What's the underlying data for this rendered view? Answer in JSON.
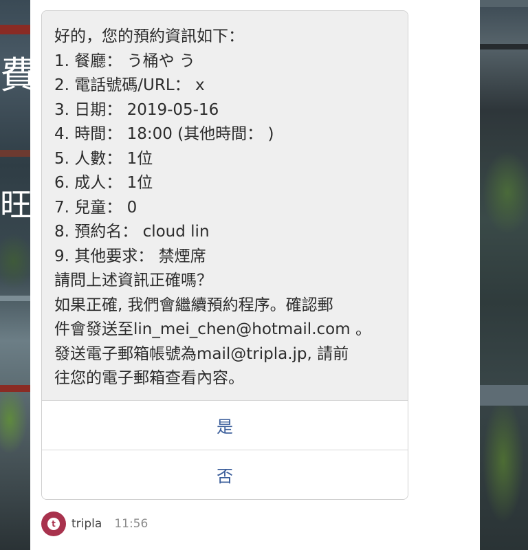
{
  "background": {
    "left_text_1": "費",
    "left_text_2": "旺"
  },
  "message": {
    "lines": [
      "好的，您的預約資訊如下：",
      "1. 餐廳： う桶や う",
      "2. 電話號碼/URL： x",
      "3. 日期： 2019-05-16",
      "4. 時間： 18:00 (其他時間： )",
      "5. 人數： 1位",
      "6. 成人： 1位",
      "7. 兒童： 0",
      "8. 預約名： cloud lin",
      "9. 其他要求： 禁煙席",
      "請問上述資訊正確嗎？",
      "如果正確, 我們會繼續預約程序。確認郵",
      "件會發送至lin_mei_chen@hotmail.com 。",
      "發送電子郵箱帳號為mail@tripla.jp, 請前",
      "往您的電子郵箱查看內容。"
    ]
  },
  "choices": {
    "yes_label": "是",
    "no_label": "否"
  },
  "meta": {
    "avatar_letter": "t",
    "sender": "tripla",
    "time": "11:56"
  },
  "colors": {
    "accent": "#3a5d9a",
    "avatar": "#a8324d",
    "bubble": "#efefef"
  }
}
